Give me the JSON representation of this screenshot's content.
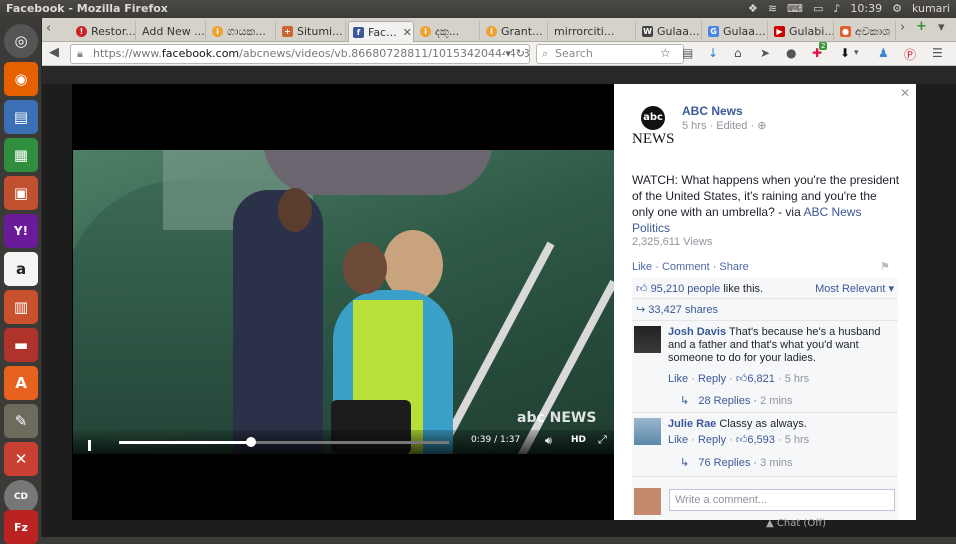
{
  "os": {
    "window_title": "Facebook - Mozilla Firefox",
    "clock": "10:39",
    "user": "kumari"
  },
  "browser": {
    "tabs": [
      {
        "label": "Restor...",
        "color": "#cc2222"
      },
      {
        "label": "Add New ...",
        "color": ""
      },
      {
        "label": "ගායක...",
        "color": "#f0a030"
      },
      {
        "label": "Situmi...",
        "color": "#cc6633"
      },
      {
        "label": "Fac...",
        "color": "#3b5998"
      },
      {
        "label": "දකු...",
        "color": "#f0a030"
      },
      {
        "label": "Grant...",
        "color": "#f0a030"
      },
      {
        "label": "mirrorciti...",
        "color": ""
      },
      {
        "label": "Gulaa...",
        "color": "#444444"
      },
      {
        "label": "Gulaa...",
        "color": "#4a86e8"
      },
      {
        "label": "Gulabi...",
        "color": "#cc0000"
      },
      {
        "label": "අවකාශ",
        "color": "#e06030"
      }
    ],
    "url_scheme": "https://www.",
    "url_host": "facebook.com",
    "url_path": "/abcnews/videos/vb.86680728811/10153420444463812/",
    "search_placeholder": "Search",
    "download_badge": "2"
  },
  "video": {
    "time": "0:39 / 1:37",
    "progress": 0.4,
    "hd_label": "HD",
    "watermark": "abc NEWS"
  },
  "post": {
    "logo_circle": "abc",
    "logo_text": "NEWS",
    "page_name": "ABC News",
    "meta": "5 hrs · Edited · ",
    "text": "WATCH: What happens when you're the president of the United States, it's raining and you're the only one with an umbrella? - via ",
    "text_link": "ABC News Politics",
    "views": "2,325,611 Views",
    "actions": "Like · Comment · Share",
    "likes_link": "95,210 people",
    "likes_suffix": " like this.",
    "sort_label": "Most Relevant",
    "shares": "33,427 shares",
    "comments": [
      {
        "name": "Josh Davis",
        "text": " That's because he's a husband and a father and that's what you'd want someone to do for your ladies.",
        "like": "Like",
        "reply": "Reply",
        "likes": "6,821",
        "time": "5 hrs",
        "replies": "28 Replies",
        "replies_time": "2 mins"
      },
      {
        "name": "Julie Rae",
        "text": " Classy as always.",
        "like": "Like",
        "reply": "Reply",
        "likes": "6,593",
        "time": "5 hrs",
        "replies": "76 Replies",
        "replies_time": "3 mins"
      }
    ],
    "write_placeholder": "Write a comment..."
  },
  "chat_label": "Chat (Off)"
}
